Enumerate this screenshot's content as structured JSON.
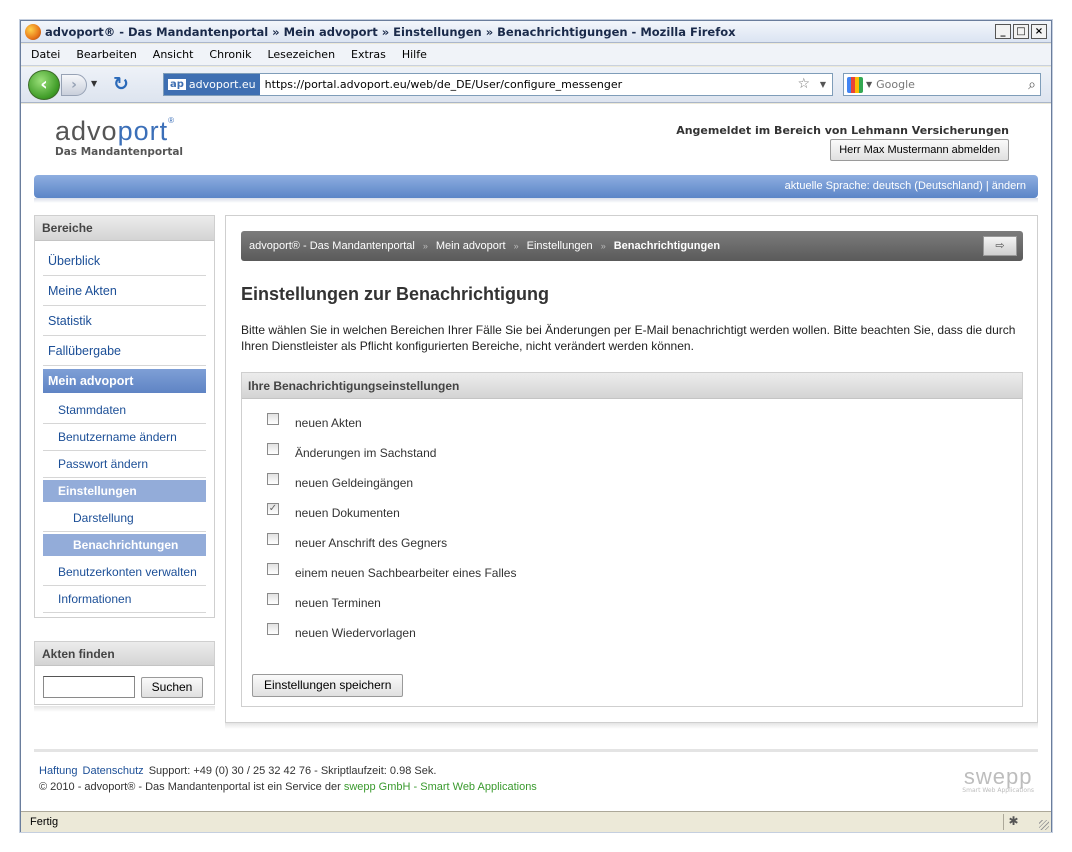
{
  "window": {
    "title": "advoport® - Das Mandantenportal » Mein advoport » Einstellungen » Benachrichtigungen - Mozilla Firefox",
    "buttons": {
      "minimize": "_",
      "maximize": "□",
      "close": "×"
    }
  },
  "menubar": [
    "Datei",
    "Bearbeiten",
    "Ansicht",
    "Chronik",
    "Lesezeichen",
    "Extras",
    "Hilfe"
  ],
  "navbar": {
    "back_icon": "arrow-left-icon",
    "site_badge_short": "ap",
    "site_badge_domain": "advoport.eu",
    "url": "https://portal.advoport.eu/web/de_DE/User/configure_messenger",
    "search_placeholder": "Google"
  },
  "header": {
    "logo_main_a": "advo",
    "logo_main_b": "port",
    "logo_reg": "®",
    "logo_sub": "Das Mandantenportal",
    "logged_in_text": "Angemeldet im Bereich von Lehmann Versicherungen",
    "logout_label": "Herr Max Mustermann abmelden"
  },
  "langbar": {
    "text": "aktuelle Sprache: deutsch (Deutschland) | ändern"
  },
  "sidebar": {
    "title": "Bereiche",
    "items": [
      {
        "label": "Überblick"
      },
      {
        "label": "Meine Akten"
      },
      {
        "label": "Statistik"
      },
      {
        "label": "Fallübergabe"
      },
      {
        "label": "Mein advoport"
      },
      {
        "label": "Stammdaten"
      },
      {
        "label": "Benutzername ändern"
      },
      {
        "label": "Passwort ändern"
      },
      {
        "label": "Einstellungen"
      },
      {
        "label": "Darstellung"
      },
      {
        "label": "Benachrichtungen"
      },
      {
        "label": "Benutzerkonten verwalten"
      },
      {
        "label": "Informationen"
      }
    ]
  },
  "find": {
    "title": "Akten finden",
    "button_label": "Suchen",
    "input_value": ""
  },
  "breadcrumb": {
    "items": [
      "advoport® - Das Mandantenportal",
      "Mein advoport",
      "Einstellungen",
      "Benachrichtigungen"
    ],
    "separator": "»"
  },
  "main": {
    "title": "Einstellungen zur Benachrichtigung",
    "intro": "Bitte wählen Sie in welchen Bereichen Ihrer Fälle Sie bei Änderungen per E-Mail benachrichtigt werden wollen. Bitte beachten Sie, dass die durch Ihren Dienstleister als Pflicht konfigurierten Bereiche, nicht verändert werden können.",
    "settings_title": "Ihre Benachrichtigungseinstellungen",
    "options": [
      {
        "label": "neuen Akten",
        "checked": false
      },
      {
        "label": "Änderungen im Sachstand",
        "checked": false
      },
      {
        "label": "neuen Geldeingängen",
        "checked": false
      },
      {
        "label": "neuen Dokumenten",
        "checked": true
      },
      {
        "label": "neuer Anschrift des Gegners",
        "checked": false
      },
      {
        "label": "einem neuen Sachbearbeiter eines Falles",
        "checked": false
      },
      {
        "label": "neuen Terminen",
        "checked": false
      },
      {
        "label": "neuen Wiedervorlagen",
        "checked": false
      }
    ],
    "save_label": "Einstellungen speichern"
  },
  "footer": {
    "link_haftung": "Haftung",
    "link_datenschutz": "Datenschutz",
    "support": "Support: +49 (0) 30 / 25 32 42 76 - Skriptlaufzeit: 0.98 Sek.",
    "copyright_prefix": "© 2010 - advoport® - Das Mandantenportal ist ein Service der",
    "copyright_link": "swepp GmbH - Smart Web Applications",
    "swepp_logo": "swepp",
    "swepp_sub": "Smart Web Applications"
  },
  "statusbar": {
    "text": "Fertig"
  },
  "colors": {
    "brand_blue": "#3b6fb8",
    "langbar": "#5b85c7",
    "active_nav": "#6d8fcc",
    "link": "#1c4f97",
    "footer_link_green": "#3a9a2e"
  }
}
